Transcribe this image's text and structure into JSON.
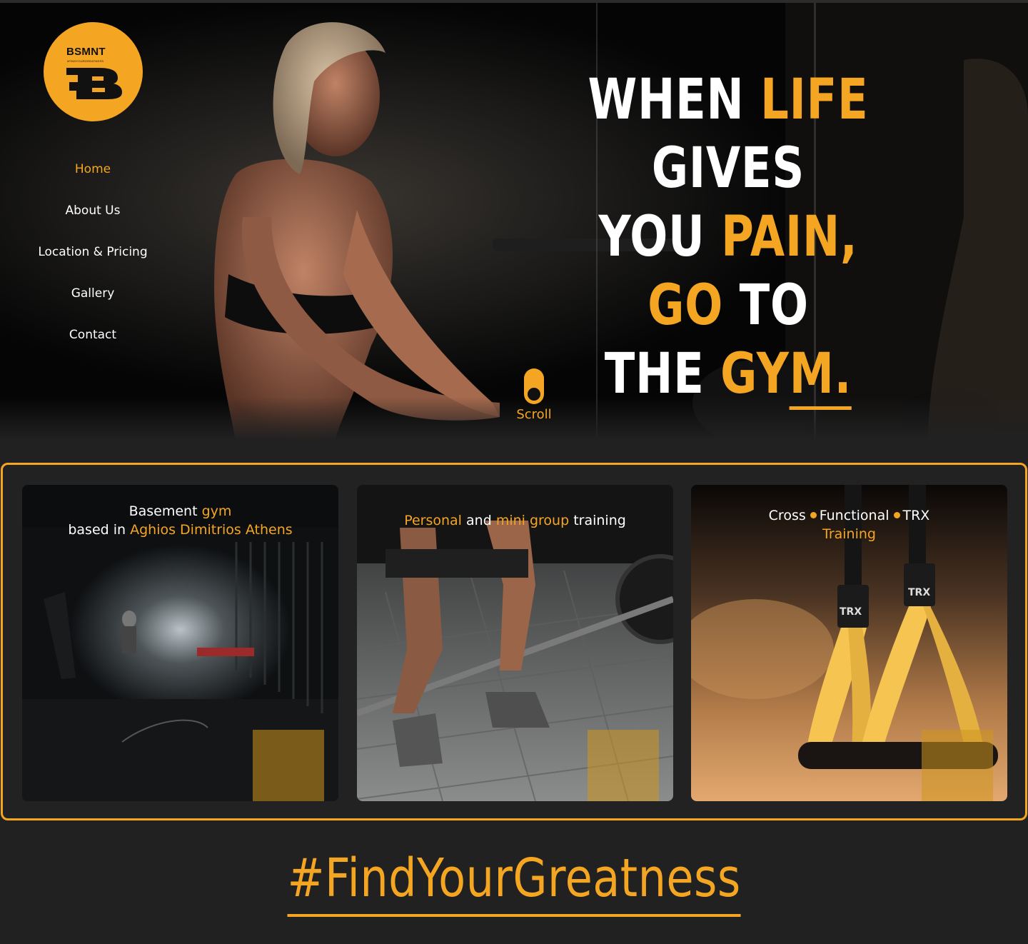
{
  "brand": {
    "name": "BSMNT",
    "hashtag_small": "#FINDYOURGREATNESS",
    "accent_color": "#f4a623",
    "background_color": "#212121"
  },
  "nav": {
    "items": [
      {
        "label": "Home",
        "active": true
      },
      {
        "label": "About Us",
        "active": false
      },
      {
        "label": "Location & Pricing",
        "active": false
      },
      {
        "label": "Gallery",
        "active": false
      },
      {
        "label": "Contact",
        "active": false
      }
    ]
  },
  "hero": {
    "line1": {
      "a": "WHEN",
      "b": "LIFE",
      "c": "GIVES"
    },
    "line2": {
      "a": "YOU",
      "b": "PAIN,"
    },
    "line3": {
      "a": "GO",
      "b": "TO"
    },
    "line4": {
      "a": "THE",
      "b": "GY",
      "c": "M."
    },
    "scroll_label": "Scroll"
  },
  "cards": [
    {
      "t1": "Basement",
      "t2": "gym",
      "t3": "based in",
      "t4": "Aghios Dimitrios Athens"
    },
    {
      "t1": "Personal",
      "t2": "and",
      "t3": "mini group",
      "t4": "training"
    },
    {
      "t1": "Cross",
      "t2": "Functional",
      "t3": "TRX",
      "t4": "Training"
    }
  ],
  "tagline": "#FindYourGreatness"
}
